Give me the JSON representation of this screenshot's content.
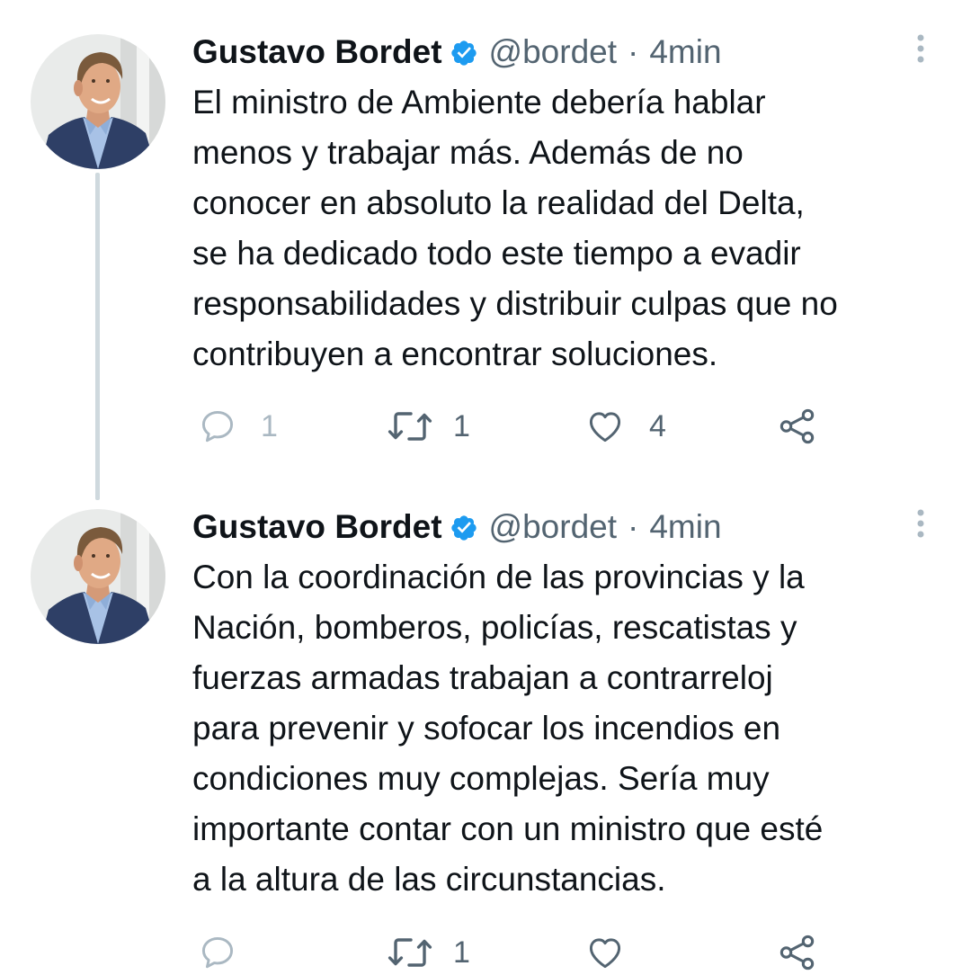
{
  "tweets": [
    {
      "author": "Gustavo Bordet",
      "handle": "@bordet",
      "separator": "·",
      "time": "4min",
      "text_lines": [
        "El ministro de Ambiente debería hablar",
        "menos y trabajar más. Además de no",
        "conocer en absoluto la realidad del Delta,",
        "se ha dedicado todo este tiempo a evadir",
        "responsabilidades y distribuir culpas que no",
        "contribuyen a encontrar soluciones."
      ],
      "replies": "1",
      "retweets": "1",
      "likes": "4"
    },
    {
      "author": "Gustavo Bordet",
      "handle": "@bordet",
      "separator": "·",
      "time": "4min",
      "text_lines": [
        "Con la coordinación de las provincias y la",
        "Nación, bomberos, policías, rescatistas y",
        "fuerzas armadas trabajan a contrarreloj",
        "para prevenir y sofocar los incendios en",
        "condiciones muy complejas. Sería muy",
        "importante contar con un ministro que esté",
        "a la altura de las circunstancias."
      ],
      "replies": "",
      "retweets": "1",
      "likes": ""
    }
  ],
  "icons": {
    "verified": "verified-badge-icon",
    "more": "more-options-icon",
    "reply": "reply-icon",
    "retweet": "retweet-icon",
    "like": "like-icon",
    "share": "share-icon"
  },
  "colors": {
    "verified": "#1d9bf0",
    "text": "#0f1419",
    "secondary": "#536471",
    "thread_line": "#cfd9de"
  }
}
